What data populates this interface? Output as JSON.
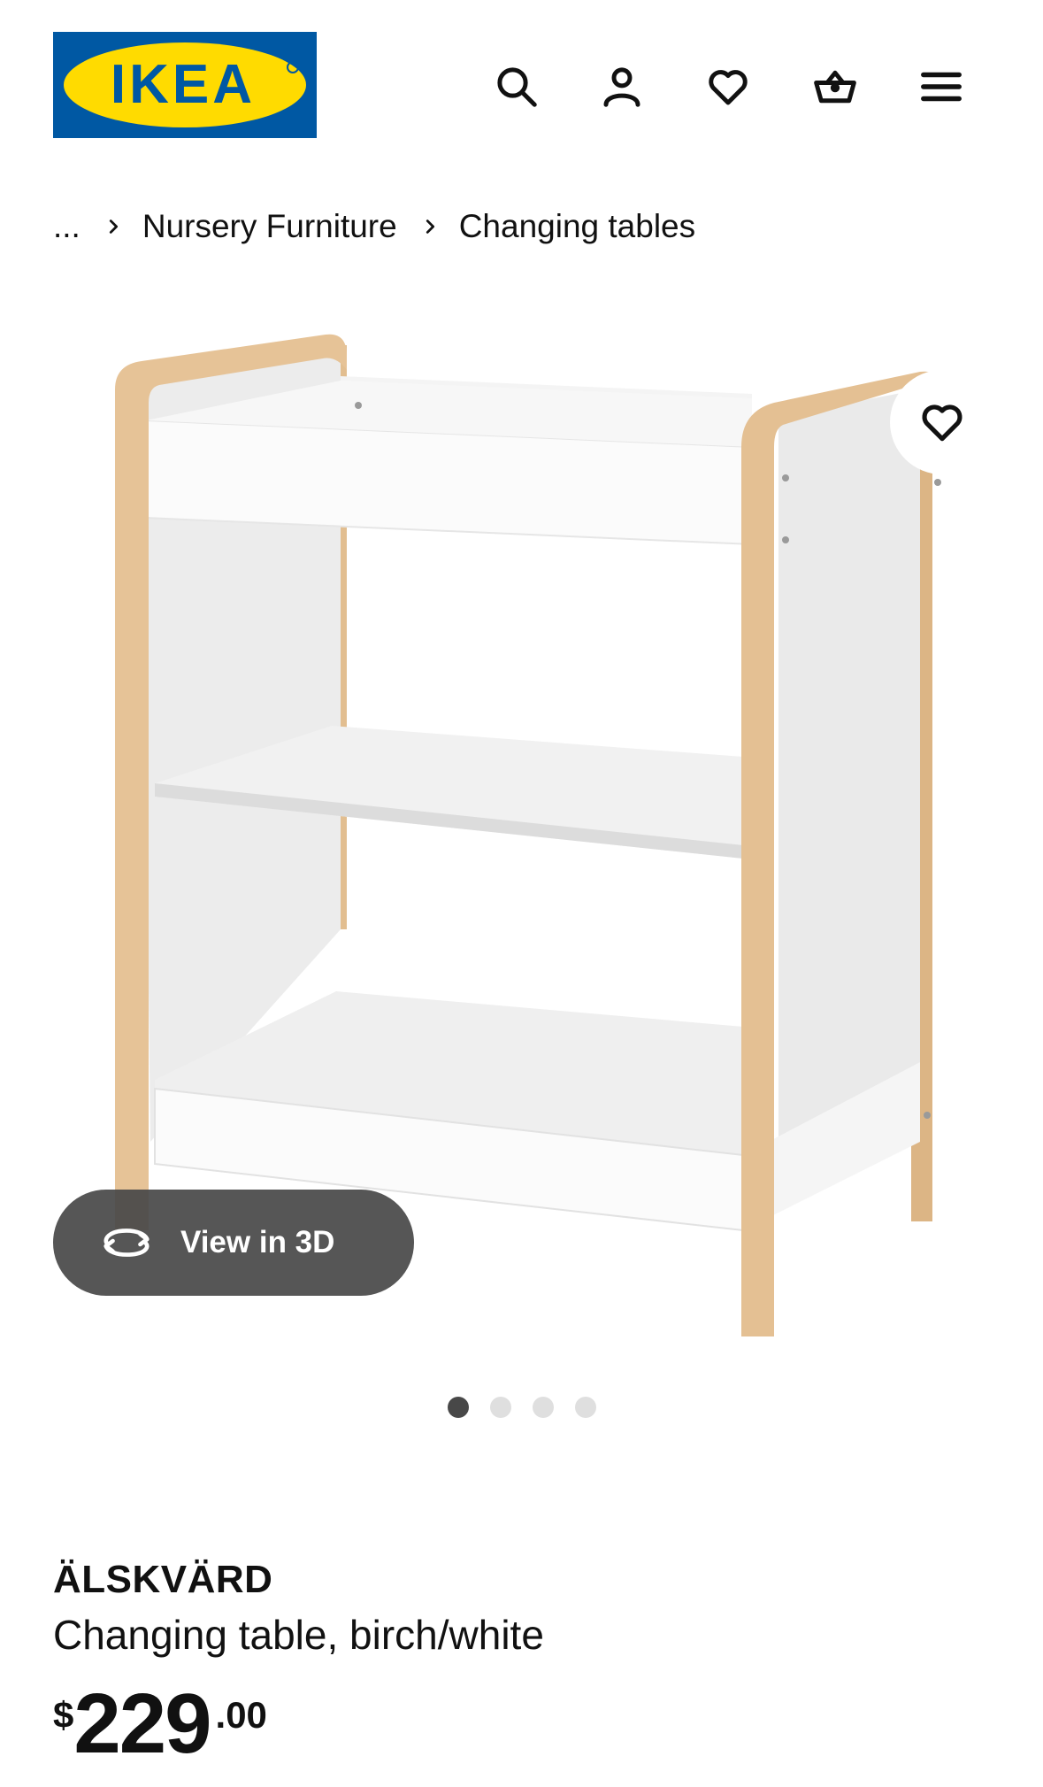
{
  "header": {
    "logo_text": "IKEA",
    "icons": [
      "search-icon",
      "user-icon",
      "heart-icon",
      "basket-icon",
      "menu-icon"
    ]
  },
  "breadcrumb": {
    "ellipsis": "...",
    "items": [
      "Nursery Furniture",
      "Changing tables"
    ]
  },
  "gallery": {
    "view_3d_label": "View in 3D",
    "dots_total": 4,
    "active_index": 0
  },
  "product": {
    "name": "ÄLSKVÄRD",
    "description": "Changing table, birch/white",
    "price": {
      "currency": "$",
      "integer": "229",
      "decimal": ".00"
    }
  },
  "colors": {
    "ikea_blue": "#0058a3",
    "ikea_yellow": "#ffdb00",
    "birch": "#e6c397",
    "dark_pill": "#484848"
  }
}
